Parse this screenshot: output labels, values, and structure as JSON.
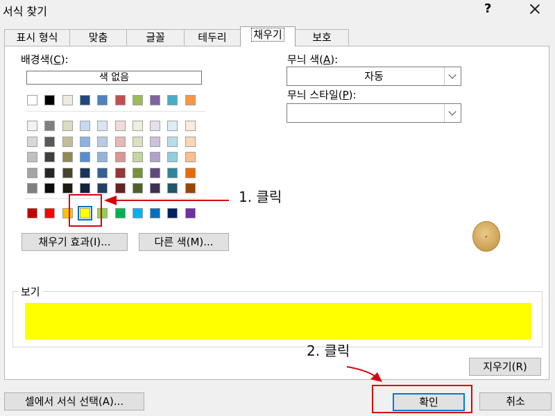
{
  "window": {
    "title": "서식 찾기",
    "help": "?"
  },
  "tabs": [
    "표시 형식",
    "맞춤",
    "글꼴",
    "테두리",
    "채우기",
    "보호"
  ],
  "background": {
    "label_pre": "배경색(",
    "label_key": "C",
    "label_post": "):",
    "no_color": "색 없음"
  },
  "palette": {
    "row1": [
      "#ffffff",
      "#000000",
      "#eeece1",
      "#1f497d",
      "#4f81bd",
      "#c0504d",
      "#9bbb59",
      "#8064a2",
      "#4bacc6",
      "#f79646"
    ],
    "grid": [
      [
        "#f2f2f2",
        "#7f7f7f",
        "#ddd9c3",
        "#c6d9f0",
        "#dbe5f1",
        "#f2dcdb",
        "#ebf1dd",
        "#e5e0ec",
        "#dbeef3",
        "#fdeada"
      ],
      [
        "#d8d8d8",
        "#595959",
        "#c4bd97",
        "#8db3e2",
        "#b8cce4",
        "#e5b9b7",
        "#d7e3bc",
        "#ccc1d9",
        "#b7dde8",
        "#fbd5b5"
      ],
      [
        "#bfbfbf",
        "#3f3f3f",
        "#938953",
        "#548dd4",
        "#95b3d7",
        "#d99694",
        "#c3d69b",
        "#b2a2c7",
        "#92cddc",
        "#fac08f"
      ],
      [
        "#a5a5a5",
        "#262626",
        "#494429",
        "#17365d",
        "#366092",
        "#953734",
        "#76923c",
        "#5f497a",
        "#31859b",
        "#e36c09"
      ],
      [
        "#7f7f7f",
        "#0c0c0c",
        "#1d1b10",
        "#0f243e",
        "#244061",
        "#632423",
        "#4f6128",
        "#3f3151",
        "#205867",
        "#974806"
      ]
    ],
    "standard": [
      "#c00000",
      "#ff0000",
      "#ffc000",
      "#ffff00",
      "#92d050",
      "#00b050",
      "#00b0f0",
      "#0070c0",
      "#002060",
      "#7030a0"
    ],
    "selected_index": 3
  },
  "buttons": {
    "fill_effects": "채우기 효과(I)...",
    "more_colors": "다른 색(M)...",
    "clear": "지우기(R)",
    "choose_from_cell": "셀에서 서식 선택(A)...",
    "ok": "확인",
    "cancel": "취소"
  },
  "pattern": {
    "color_label_pre": "무늬 색(",
    "color_label_key": "A",
    "color_label_post": "):",
    "color_value": "자동",
    "style_label_pre": "무늬 스타일(",
    "style_label_key": "P",
    "style_label_post": "):",
    "style_value": ""
  },
  "preview": {
    "label": "보기",
    "color": "#ffff00"
  },
  "annotations": {
    "step1": "1. 클릭",
    "step2": "2. 클릭",
    "color": "#d8000c"
  }
}
